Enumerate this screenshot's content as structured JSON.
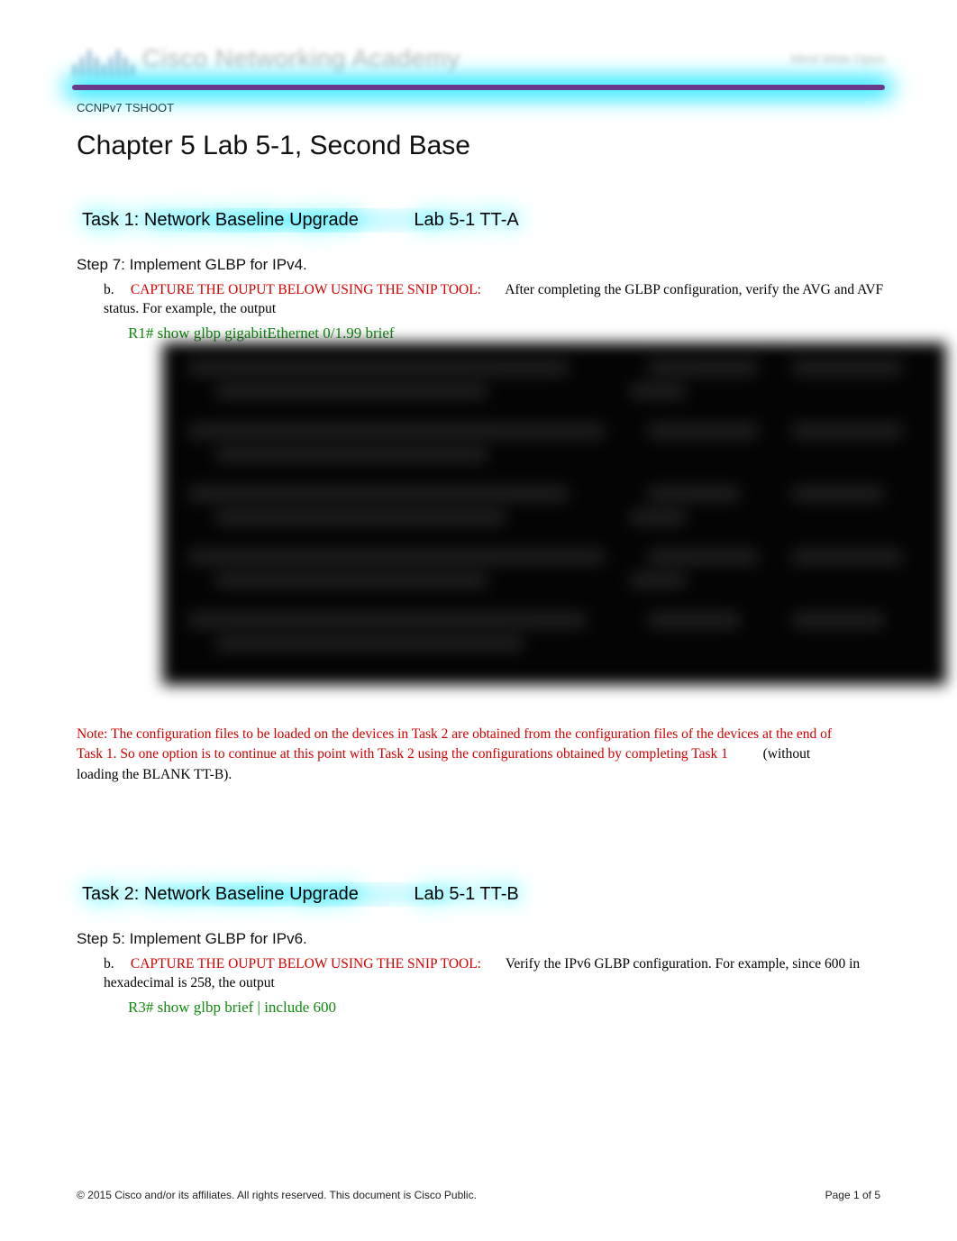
{
  "header": {
    "academy_text": "Cisco Networking Academy",
    "tagline": "Mind Wide Open"
  },
  "course_code": "CCNPv7 TSHOOT",
  "chapter_title": "Chapter 5 Lab 5-1, Second Base",
  "task1": {
    "heading_a": "Task 1: Network Baseline Upgrade",
    "heading_b": "Lab 5-1 TT-A",
    "step": "Step 7: Implement GLBP for IPv4.",
    "item_letter": "b.",
    "capture_red": "CAPTURE THE OUPUT BELOW USING THE SNIP TOOL:",
    "capture_after": "After completing the GLBP configuration, verify the AVG and AVF status. For example, the output",
    "cmd": "R1# show glbp gigabitEthernet 0/1.99 brief"
  },
  "note": {
    "red_part1": "Note:   The configuration files to be loaded on the devices in Task 2 are obtained from the configuration files of the devices at the end of Task 1. So one option is to continue at this point with Task 2 using the configurations obtained by completing Task 1",
    "black_part": "(without loading the BLANK TT-B)."
  },
  "task2": {
    "heading_a": "Task 2: Network Baseline Upgrade",
    "heading_b": "Lab 5-1 TT-B",
    "step": "Step 5: Implement GLBP for IPv6.",
    "item_letter": "b.",
    "capture_red": "CAPTURE THE OUPUT BELOW USING THE SNIP TOOL:",
    "capture_after": "Verify the IPv6 GLBP configuration. For example, since 600 in hexadecimal is 258, the output",
    "cmd": "R3# show glbp brief | include 600"
  },
  "footer": {
    "left": "© 2015 Cisco and/or its affiliates. All rights reserved. This document is Cisco Public.",
    "right": "Page 1 of 5"
  }
}
